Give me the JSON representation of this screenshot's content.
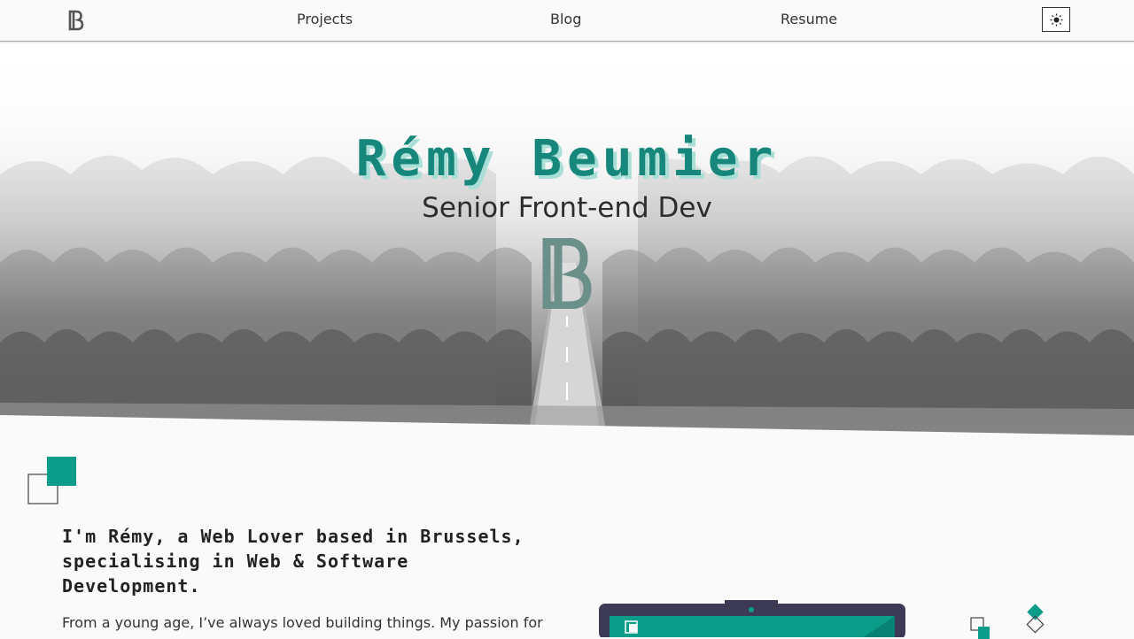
{
  "nav": {
    "logo_icon": "rb-monogram-icon",
    "links": [
      "Projects",
      "Blog",
      "Resume"
    ],
    "theme_toggle_icon": "sun-icon"
  },
  "hero": {
    "title": "Rémy Beumier",
    "subtitle": "Senior Front-end Dev",
    "logo_icon": "rb-monogram-icon"
  },
  "intro": {
    "heading": "I'm Rémy, a Web Lover based in Brussels, specialising in Web & Software Development.",
    "text": "From a young age, I’ve always loved building things. My passion for"
  },
  "colors": {
    "accent": "#0b9c8a",
    "title_shadow": "#a9dfd7",
    "laptop_body": "#3d3a56"
  }
}
